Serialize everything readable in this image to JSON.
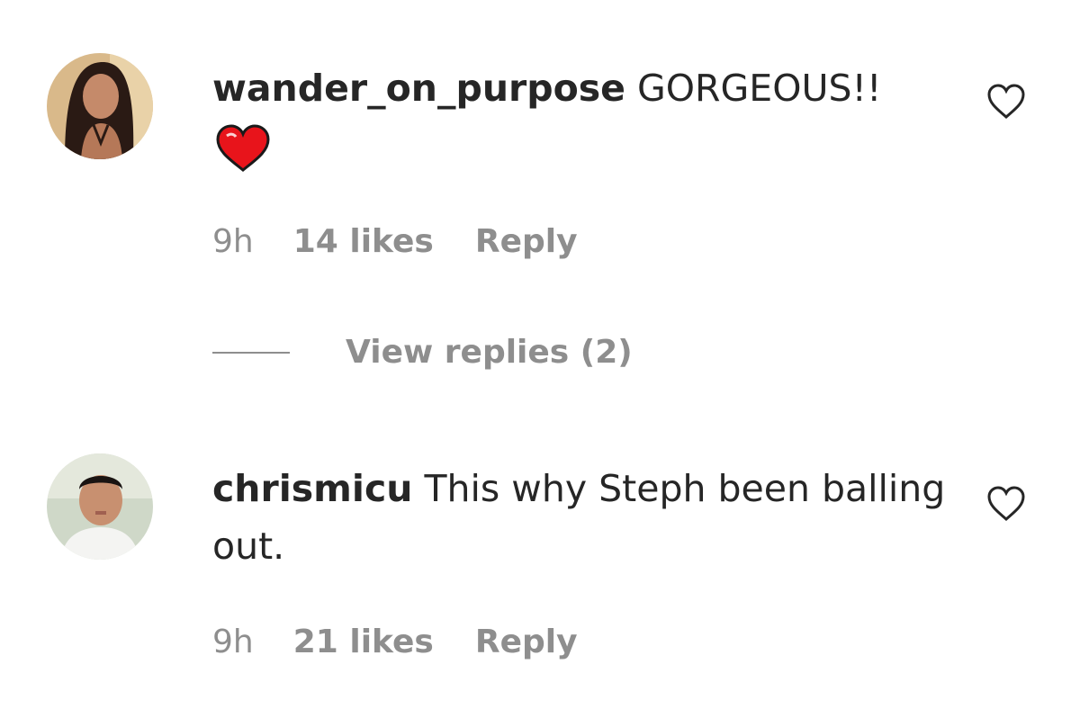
{
  "comments": [
    {
      "username": "wander_on_purpose",
      "text": "GORGEOUS!!",
      "emoji": "red-heart-emoji",
      "time": "9h",
      "likes": "14 likes",
      "reply": "Reply",
      "view_replies": "View replies (2)"
    },
    {
      "username": "chrismicu",
      "text": "This why Steph been balling out.",
      "time": "9h",
      "likes": "21 likes",
      "reply": "Reply"
    }
  ],
  "icons": {
    "like": "heart-outline-icon"
  },
  "colors": {
    "username": "#262626",
    "meta": "#8e8e8e",
    "heart_emoji": "#e8141b"
  }
}
